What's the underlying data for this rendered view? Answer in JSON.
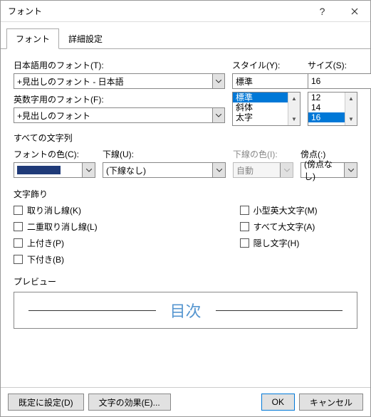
{
  "window": {
    "title": "フォント"
  },
  "tabs": {
    "font": "フォント",
    "advanced": "詳細設定"
  },
  "jp": {
    "label": "日本語用のフォント(T):",
    "value": "+見出しのフォント - 日本語"
  },
  "en": {
    "label": "英数字用のフォント(F):",
    "value": "+見出しのフォント"
  },
  "style": {
    "label": "スタイル(Y):",
    "value": "標準",
    "options": [
      "標準",
      "斜体",
      "太字"
    ],
    "selected": "標準"
  },
  "size": {
    "label": "サイズ(S):",
    "value": "16",
    "options": [
      "12",
      "14",
      "16"
    ],
    "selected": "16"
  },
  "allchars": "すべての文字列",
  "fontcolor": {
    "label": "フォントの色(C):",
    "value": "#1f3a78"
  },
  "underline": {
    "label": "下線(U):",
    "value": "(下線なし)"
  },
  "ulcolor": {
    "label": "下線の色(I):",
    "value": "自動"
  },
  "emphasis": {
    "label": "傍点(:)",
    "value": "(傍点なし)"
  },
  "decoration": "文字飾り",
  "checks": {
    "strike": "取り消し線(K)",
    "dstrike": "二重取り消し線(L)",
    "sup": "上付き(P)",
    "sub": "下付き(B)",
    "smallcaps": "小型英大文字(M)",
    "allcaps": "すべて大文字(A)",
    "hidden": "隠し文字(H)"
  },
  "preview": {
    "label": "プレビュー",
    "text": "目次"
  },
  "buttons": {
    "setdefault": "既定に設定(D)",
    "texteffects": "文字の効果(E)...",
    "ok": "OK",
    "cancel": "キャンセル"
  }
}
